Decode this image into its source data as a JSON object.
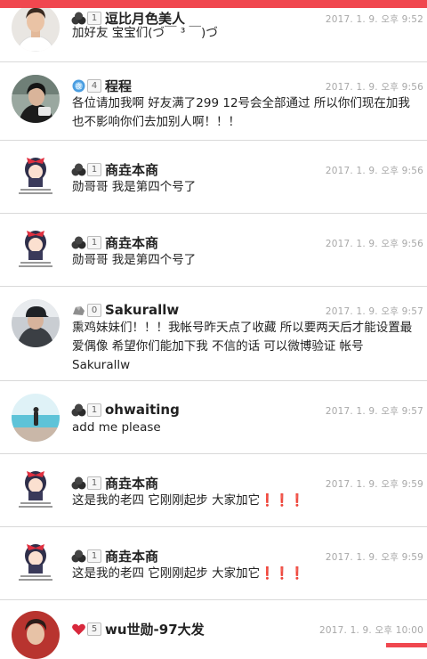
{
  "colors": {
    "accent": "#f0474f",
    "divider": "#d9d9d9",
    "time": "#a8a8a8"
  },
  "comments": [
    {
      "name": "逗比月色美人",
      "level": "1",
      "badge_icon": "coal-rank-icon",
      "time": "2017. 1. 9. 오후 9:52",
      "text": "加好友 宝宝们(づ￣ ³ ￣)づ",
      "avatar": "avatar-man-white-shirt"
    },
    {
      "name": "程程",
      "level": "4",
      "badge_icon": "blue-diamond-rank-icon",
      "time": "2017. 1. 9. 오후 9:56",
      "text": "各位请加我啊 好友满了299 12号会全部通过 所以你们现在加我也不影响你们去加别人啊！！！",
      "avatar": "avatar-person-dark-hair"
    },
    {
      "name": "商垚本商",
      "level": "1",
      "badge_icon": "coal-rank-icon",
      "time": "2017. 1. 9. 오후 9:56",
      "text": "勋哥哥 我是第四个号了",
      "avatar": "avatar-cartoon-girl-red-bow"
    },
    {
      "name": "商垚本商",
      "level": "1",
      "badge_icon": "coal-rank-icon",
      "time": "2017. 1. 9. 오후 9:56",
      "text": "勋哥哥 我是第四个号了",
      "avatar": "avatar-cartoon-girl-red-bow"
    },
    {
      "name": "Sakurallw",
      "level": "0",
      "badge_icon": "stone-rank-icon",
      "time": "2017. 1. 9. 오후 9:57",
      "text": "熏鸡妹妹们！！！我帐号昨天点了收藏 所以要两天后才能设置最爱偶像 希望你们能加下我 不信的话 可以微博验证 帐号Sakurallw",
      "avatar": "avatar-man-cap"
    },
    {
      "name": "ohwaiting",
      "level": "1",
      "badge_icon": "coal-rank-icon",
      "time": "2017. 1. 9. 오후 9:57",
      "text": "add me please",
      "avatar": "avatar-sea-figure"
    },
    {
      "name": "商垚本商",
      "level": "1",
      "badge_icon": "coal-rank-icon",
      "time": "2017. 1. 9. 오후 9:59",
      "text": "这是我的老四 它刚刚起步 大家加它❗️❗️❗️",
      "avatar": "avatar-cartoon-girl-red-bow"
    },
    {
      "name": "商垚本商",
      "level": "1",
      "badge_icon": "coal-rank-icon",
      "time": "2017. 1. 9. 오후 9:59",
      "text": "这是我的老四 它刚刚起步 大家加它❗️❗️❗️",
      "avatar": "avatar-cartoon-girl-red-bow"
    },
    {
      "name": "wu世勋-97大发",
      "level": "5",
      "badge_icon": "red-heart-rank-icon",
      "time": "2017. 1. 9. 오후 10:00",
      "text": "",
      "avatar": "avatar-man-red-bg"
    }
  ]
}
